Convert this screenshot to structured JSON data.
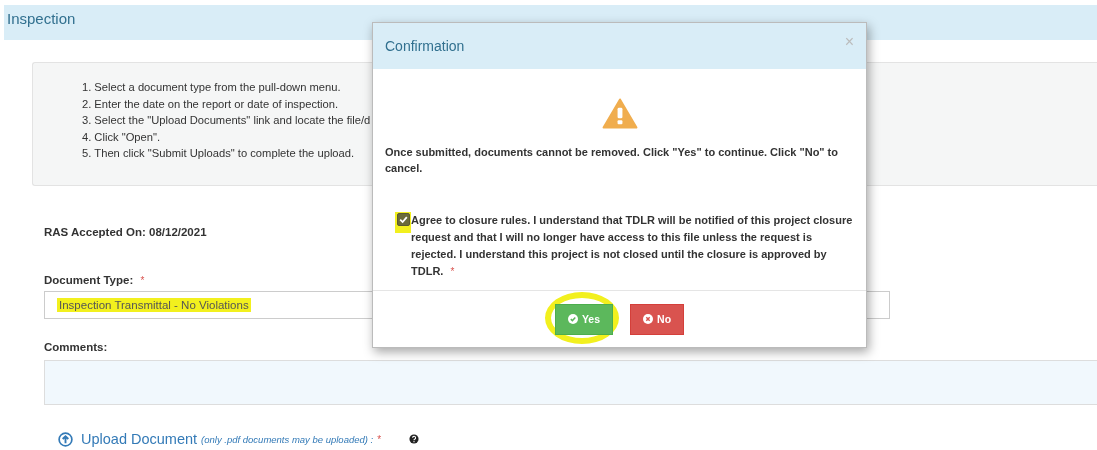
{
  "page": {
    "title": "Inspection"
  },
  "instructions": [
    {
      "number": "1.",
      "text": "Select a document type from the pull-down menu."
    },
    {
      "number": "2.",
      "text": "Enter the date on the report or date of inspection."
    },
    {
      "number": "3.",
      "text": "Select the \"Upload Documents\" link and locate the file/d"
    },
    {
      "number": "4.",
      "text": "Click \"Open\"."
    },
    {
      "number": "5.",
      "text": "Then click \"Submit Uploads\" to complete the upload."
    }
  ],
  "accepted": "RAS Accepted On: 08/12/2021",
  "document_type": {
    "label": "Document Type:",
    "required": "*",
    "value": "Inspection Transmittal - No Violations",
    "highlighted": true
  },
  "comments": {
    "label": "Comments:"
  },
  "upload": {
    "label": "Upload Document",
    "hint": "(only .pdf documents may be uploaded) :",
    "required": "*"
  },
  "dialog": {
    "title": "Confirmation",
    "close": "×",
    "message": "Once submitted, documents cannot be removed. Click \"Yes\" to continue. Click \"No\" to cancel.",
    "agreement": {
      "text": "Agree to closure rules. I understand that TDLR will be notified of this project closure request and that I will no longer have access to this file unless the request is rejected. I understand this project is not closed until the closure is approved by TDLR.",
      "required": "*",
      "checked": true,
      "highlighted": true
    },
    "buttons": [
      {
        "kind": "confirm",
        "label": "Yes",
        "highlighted": true
      },
      {
        "kind": "cancel",
        "label": "No",
        "highlighted": false
      }
    ]
  }
}
